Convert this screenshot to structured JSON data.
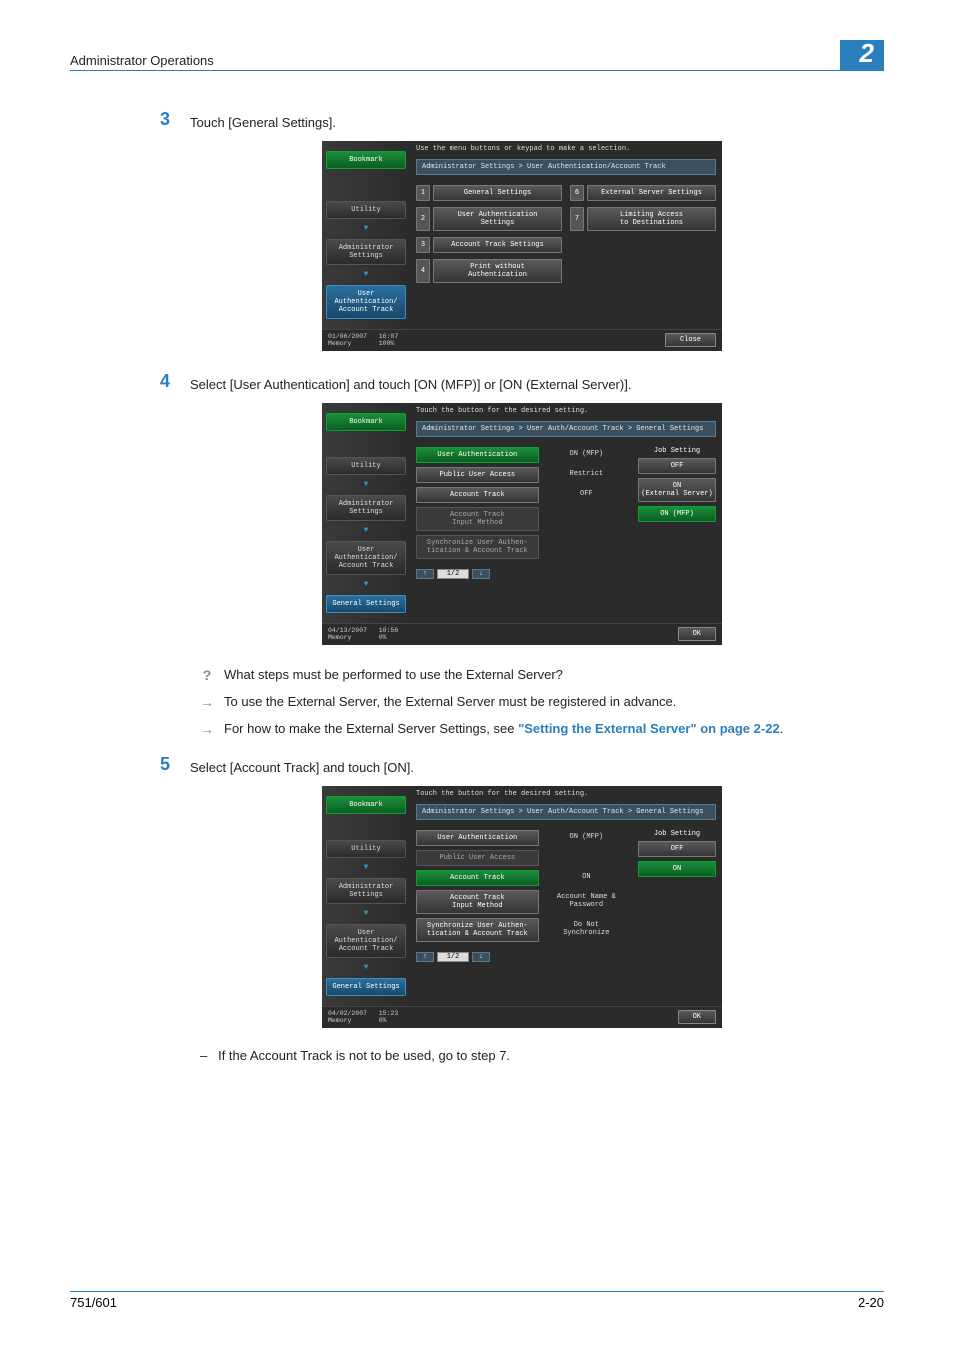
{
  "header": {
    "title": "Administrator Operations",
    "chapter": "2"
  },
  "steps": {
    "s3": {
      "num": "3",
      "text": "Touch [General Settings]."
    },
    "s4": {
      "num": "4",
      "text": "Select [User Authentication] and touch [ON (MFP)] or [ON (External Server)]."
    },
    "s5": {
      "num": "5",
      "text": "Select [Account Track] and touch [ON]."
    }
  },
  "qa": {
    "q": "What steps must be performed to use the External Server?",
    "a1": "To use the External Server, the External Server must be registered in advance.",
    "a2_pre": "For how to make the External Server Settings, see ",
    "a2_link": "\"Setting the External Server\" on page 2-22",
    "a2_post": "."
  },
  "dash5": "If the Account Track is not to be used, go to step 7.",
  "screen1": {
    "instr": "Use the menu buttons or keypad to make a selection.",
    "crumb": "Administrator Settings > User Authentication/Account Track",
    "side": {
      "bookmark": "Bookmark",
      "utility": "Utility",
      "admin": "Administrator\nSettings",
      "uaat": "User\nAuthentication/\nAccount Track"
    },
    "items": {
      "i1": "General Settings",
      "i2": "User Authentication\nSettings",
      "i3": "Account Track Settings",
      "i4": "Print without\nAuthentication",
      "i6": "External Server Settings",
      "i7": "Limiting Access\nto Destinations"
    },
    "footer": {
      "date": "01/06/2007",
      "time": "16:07",
      "mem": "Memory",
      "memv": "100%",
      "close": "Close"
    }
  },
  "screen2": {
    "instr": "Touch the button for the desired setting.",
    "crumb": "Administrator Settings > User Auth/Account Track  > General Settings",
    "side": {
      "bookmark": "Bookmark",
      "utility": "Utility",
      "admin": "Administrator\nSettings",
      "uaat": "User\nAuthentication/\nAccount Track",
      "gen": "General Settings"
    },
    "rows": {
      "r1l": "User Authentication",
      "r1v": "ON (MFP)",
      "r2l": "Public User Access",
      "r2v": "Restrict",
      "r3l": "Account Track",
      "r3v": "OFF",
      "r4l": "Account Track\nInput Method",
      "r5l": "Synchronize User Authen-\ntication & Account Track"
    },
    "job": {
      "hdr": "Job Setting",
      "b1": "OFF",
      "b2": "ON\n(External Server)",
      "b3": "ON (MFP)"
    },
    "pager": "1/2",
    "footer": {
      "date": "04/13/2007",
      "time": "10:56",
      "mem": "Memory",
      "memv": "0%",
      "ok": "OK"
    }
  },
  "screen3": {
    "instr": "Touch the button for the desired setting.",
    "crumb": "Administrator Settings > User Auth/Account Track  > General Settings",
    "side": {
      "bookmark": "Bookmark",
      "utility": "Utility",
      "admin": "Administrator\nSettings",
      "uaat": "User\nAuthentication/\nAccount Track",
      "gen": "General Settings"
    },
    "rows": {
      "r1l": "User Authentication",
      "r1v": "ON (MFP)",
      "r2l": "Public User Access",
      "r3l": "Account Track",
      "r3v": "ON",
      "r4l": "Account Track\nInput Method",
      "r4v": "Account Name &\nPassword",
      "r5l": "Synchronize User Authen-\ntication & Account Track",
      "r5v": "Do Not\nSynchronize"
    },
    "job": {
      "hdr": "Job Setting",
      "b1": "OFF",
      "b2": "ON"
    },
    "pager": "1/2",
    "footer": {
      "date": "04/02/2007",
      "time": "15:23",
      "mem": "Memory",
      "memv": "0%",
      "ok": "OK"
    }
  },
  "pagefoot": {
    "left": "751/601",
    "right": "2-20"
  }
}
